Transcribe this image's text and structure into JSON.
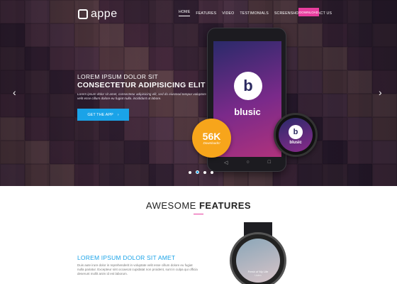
{
  "header": {
    "logo_text": "appe",
    "nav": [
      "HOME",
      "FEATURES",
      "VIDEO",
      "TESTIMONIALS",
      "SCREENSHOT",
      "CONTACT US"
    ],
    "download_label": "DOWNLOAD"
  },
  "hero": {
    "title_line1": "LOREM IPSUM DOLOR SIT",
    "title_line2": "CONSECTETUR ADIPISICING ELIT",
    "body": "Lorem ipsum dolor sit amet, consectetur adipisicing elit, sed do eiusmod tempor voluptate velit esse cillum dolore eu fugiat nulla. incididunt ut labore.",
    "cta_label": "GET THE APP",
    "prev_icon": "chevron-left-icon",
    "next_icon": "chevron-right-icon",
    "badge_number": "56K",
    "badge_label": "Downloads!",
    "app_name": "blusic",
    "app_letter": "b",
    "slides_count": 4,
    "active_slide": 2
  },
  "features": {
    "title_light": "AWESOME ",
    "title_bold": "FEATURES",
    "item_heading": "LOREM IPSUM DOLOR SIT AMET",
    "item_body": "Duis aute irure dolor in reprehenderit in voluptate velit esse cillum dolore eu fugiat nulla pariatur. Excepteur sint occaecat cupidatat non proident, sunt in culpa qui officia deserunt mollit anim id est laborum.",
    "watch_song": "Fresh of My Life",
    "watch_artist": "Listen"
  },
  "colors": {
    "accent_blue": "#1aa3e8",
    "accent_pink": "#e83e9f",
    "accent_orange": "#f7a51b"
  }
}
